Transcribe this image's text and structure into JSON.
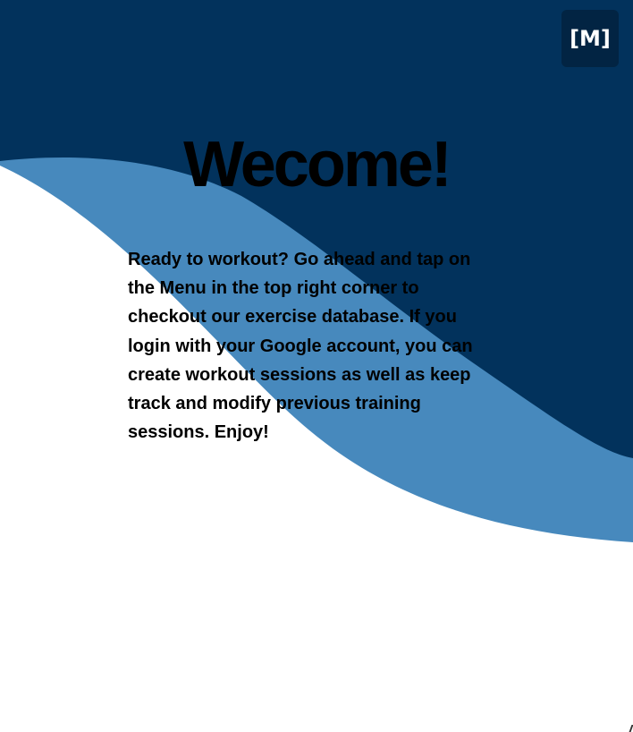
{
  "header": {
    "menu_label": "[M]"
  },
  "main": {
    "title": "Wecome!",
    "intro": "Ready to workout? Go ahead and tap on the Menu in the top right corner to checkout our exercise database. If you login with your Google account, you can create workout sessions as well as keep track and modify previous training sessions. Enjoy!"
  },
  "colors": {
    "dark_blue": "#02325C",
    "light_blue": "#4789BD",
    "menu_button_bg": "#022443",
    "background": "#FFFFFF",
    "text": "#000000"
  }
}
